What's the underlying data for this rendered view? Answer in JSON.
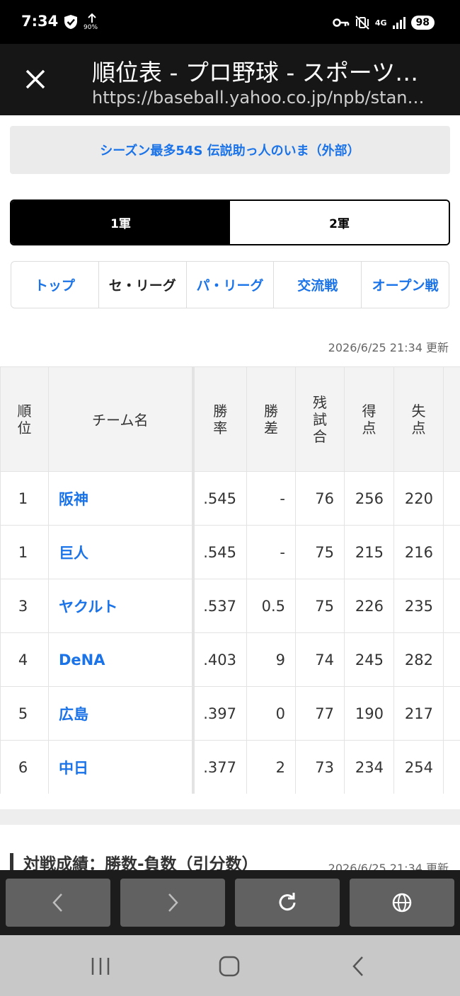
{
  "status_bar": {
    "time": "7:34",
    "upload_percent": "90%",
    "network": "4G",
    "battery": "98"
  },
  "browser": {
    "title": "順位表 - プロ野球 - スポーツナビ",
    "url": "https://baseball.yahoo.co.jp/npb/standings/"
  },
  "banner": {
    "text": "シーズン最多54S 伝説助っ人のいま（外部）"
  },
  "squad_toggle": {
    "first": "1軍",
    "second": "2軍"
  },
  "league_tabs": [
    "トップ",
    "セ・リーグ",
    "パ・リーグ",
    "交流戦",
    "オープン戦"
  ],
  "updated": "2026/6/25 21:34 更新",
  "table": {
    "headers": [
      "順位",
      "チーム名",
      "勝率",
      "勝差",
      "残試合",
      "得点",
      "失点",
      ""
    ],
    "rows": [
      {
        "rank": "1",
        "team": "阪神",
        "pct": ".545",
        "gb": "-",
        "remaining": "76",
        "runs": "256",
        "allowed": "220"
      },
      {
        "rank": "1",
        "team": "巨人",
        "pct": ".545",
        "gb": "-",
        "remaining": "75",
        "runs": "215",
        "allowed": "216"
      },
      {
        "rank": "3",
        "team": "ヤクルト",
        "pct": ".537",
        "gb": "0.5",
        "remaining": "75",
        "runs": "226",
        "allowed": "235"
      },
      {
        "rank": "4",
        "team": "DeNA",
        "pct": ".403",
        "gb": "9",
        "remaining": "74",
        "runs": "245",
        "allowed": "282"
      },
      {
        "rank": "5",
        "team": "広島",
        "pct": ".397",
        "gb": "0",
        "remaining": "77",
        "runs": "190",
        "allowed": "217"
      },
      {
        "rank": "6",
        "team": "中日",
        "pct": ".377",
        "gb": "2",
        "remaining": "73",
        "runs": "234",
        "allowed": "254"
      }
    ]
  },
  "section": {
    "title": "対戦成績：勝数-負数（引分数）",
    "updated": "2026/6/25 21:34 更新"
  },
  "colors": {
    "link": "#1a73e8",
    "header_bg": "#161616"
  }
}
